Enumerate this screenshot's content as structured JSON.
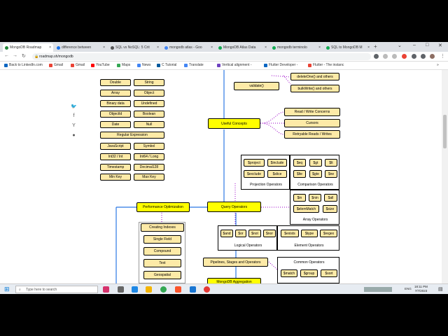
{
  "browser": {
    "tabs": [
      {
        "title": "MongoDB Roadmap",
        "active": true,
        "color": "#22863a"
      },
      {
        "title": "difference between",
        "active": false,
        "color": "#1a73e8"
      },
      {
        "title": "SQL vs NoSQL: 5 Crit",
        "active": false,
        "color": "#555555"
      },
      {
        "title": "mongodb atlas - Goo",
        "active": false,
        "color": "#4285f4"
      },
      {
        "title": "MongoDB Atlas Data",
        "active": false,
        "color": "#13aa52"
      },
      {
        "title": "mongodb terminolo",
        "active": false,
        "color": "#13aa52"
      },
      {
        "title": "SQL to MongoDB M",
        "active": false,
        "color": "#13aa52"
      }
    ],
    "new_tab": "+",
    "url": "roadmap.sh/mongodb",
    "bookmarks": [
      {
        "label": "Back to LinkedIn.com",
        "color": "#0a66c2"
      },
      {
        "label": "Gmail",
        "color": "#ea4335"
      },
      {
        "label": "Gmail",
        "color": "#ea4335"
      },
      {
        "label": "YouTube",
        "color": "#ff0000"
      },
      {
        "label": "Maps",
        "color": "#34a853"
      },
      {
        "label": "News",
        "color": "#4285f4"
      },
      {
        "label": "C Tutorial",
        "color": "#00599c"
      },
      {
        "label": "Translate",
        "color": "#4285f4"
      },
      {
        "label": "Vertical alignment -",
        "color": "#6f42c1"
      },
      {
        "label": "Flutter Developer -",
        "color": "#0a66c2"
      },
      {
        "label": "Flutter - The instanc",
        "color": "#ea4335"
      }
    ],
    "more_bookmarks": "»"
  },
  "roadmap": {
    "datatypes": [
      "Double",
      "String",
      "Array",
      "Object",
      "Binary data",
      "Undefined",
      "ObjectId",
      "Boolean",
      "Date",
      "Null",
      "Regular Expression",
      "JavaScript",
      "Symbol",
      "Int32 / Int",
      "Int64 / Long",
      "Timestamp",
      "Decimal128",
      "Min Key",
      "Max Key"
    ],
    "top_nodes": [
      "deleteOne() and others",
      "bulkWrite() and others",
      "validate()"
    ],
    "useful_concepts": "Useful Concepts",
    "concepts": [
      "Read / Write Concerns",
      "Cursors",
      "Retryable Reads / Writes"
    ],
    "projection": {
      "items": [
        "$project",
        "$include",
        "$exclude",
        "$slice"
      ],
      "label": "Projection Operators"
    },
    "comparison": {
      "items": [
        "$eq",
        "$gt",
        "$lt",
        "$lte",
        "$gte",
        "$ne"
      ],
      "label": "Comparison Operators"
    },
    "array_ops": {
      "items": [
        "$in",
        "$nin",
        "$all",
        "$elemMatch",
        "$size"
      ],
      "label": "Array Operators"
    },
    "query_operators": "Query Operators",
    "performance": "Performance Optimization",
    "logical": {
      "items": [
        "$and",
        "$or",
        "$not",
        "$nor"
      ],
      "label": "Logical Operators"
    },
    "element": {
      "items": [
        "$exists",
        "$type",
        "$regex"
      ],
      "label": "Element Operators"
    },
    "indexes": [
      "Creating Indexes",
      "Single Field",
      "Compound",
      "Text",
      "Geospatial"
    ],
    "pipelines": "Pipelines, Stages and Operators",
    "common": {
      "label": "Common Operators",
      "items": [
        "$match",
        "$group",
        "$sort"
      ]
    },
    "aggregation": "MongoDB Aggregation"
  },
  "taskbar": {
    "search_placeholder": "Type here to search",
    "time": "18:11 PM",
    "date": "7/7/2023",
    "language": "ENG"
  }
}
